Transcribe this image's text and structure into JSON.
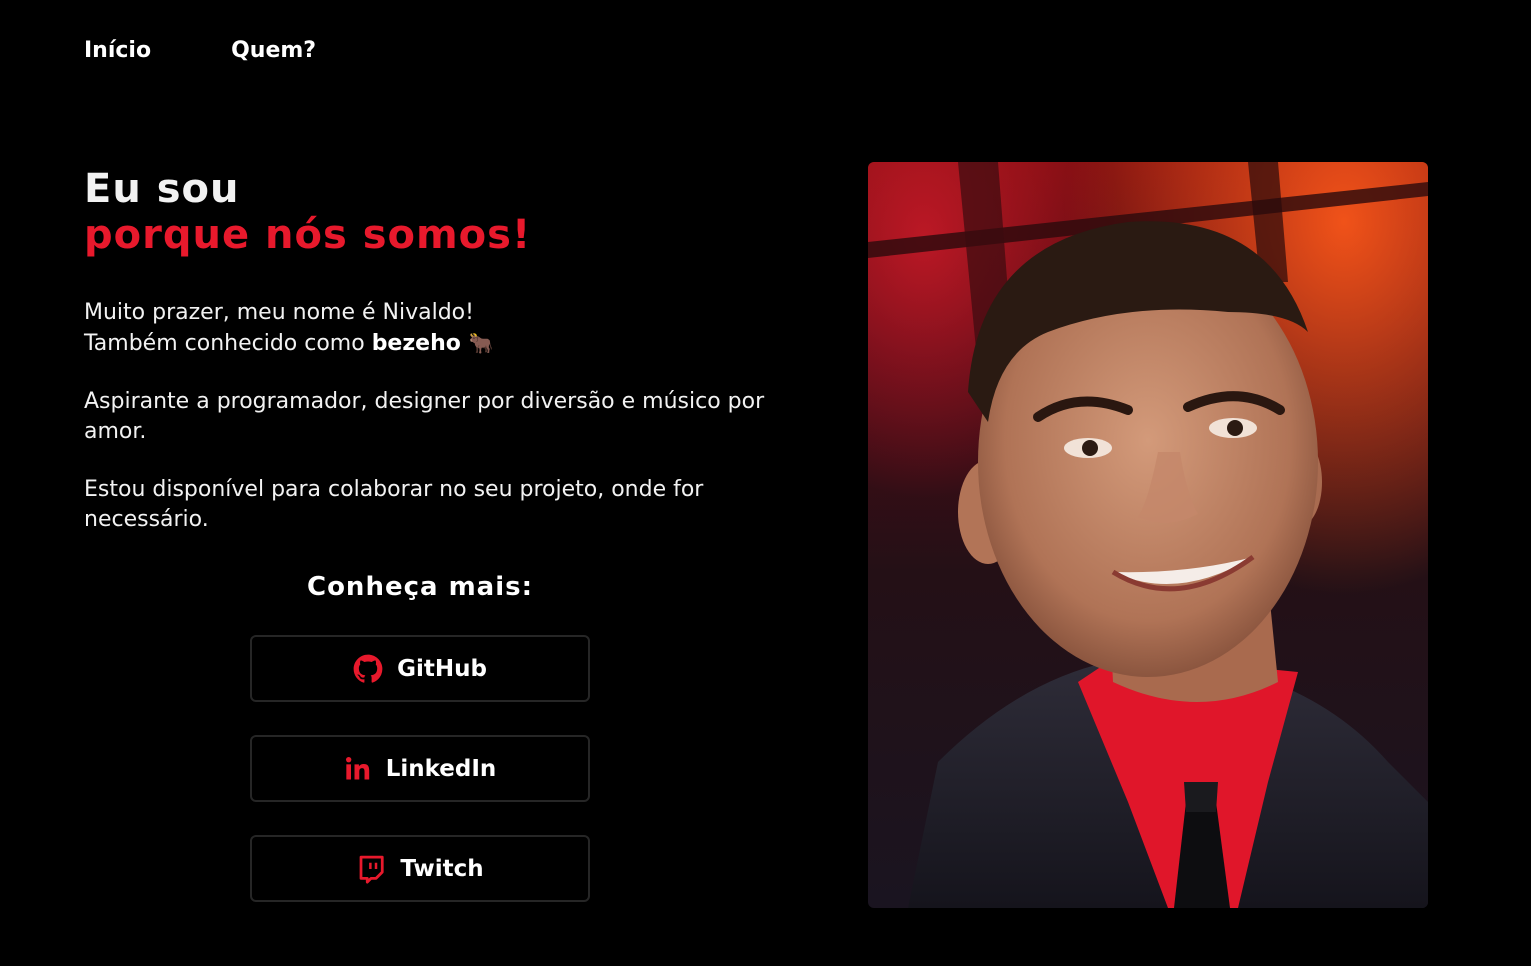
{
  "nav": {
    "items": [
      {
        "label": "Início"
      },
      {
        "label": "Quem?"
      }
    ]
  },
  "hero": {
    "title_line1": "Eu sou",
    "title_line2": "porque nós somos!"
  },
  "intro": {
    "greeting": "Muito prazer, meu nome é Nivaldo!",
    "alias_prefix": "Também conhecido como",
    "alias_name": "bezeho",
    "alias_emoji": "🐂",
    "description": "Aspirante a programador, designer por diversão e músico por amor.",
    "availability": "Estou disponível para colaborar no seu projeto, onde for necessário."
  },
  "links_section": {
    "title": "Conheça mais:",
    "links": [
      {
        "label": "GitHub",
        "icon": "github-icon"
      },
      {
        "label": "LinkedIn",
        "icon": "linkedin-icon"
      },
      {
        "label": "Twitch",
        "icon": "twitch-icon"
      }
    ]
  },
  "colors": {
    "accent": "#e8192c",
    "background": "#000000",
    "text": "#ffffff",
    "button_border": "#262626"
  }
}
